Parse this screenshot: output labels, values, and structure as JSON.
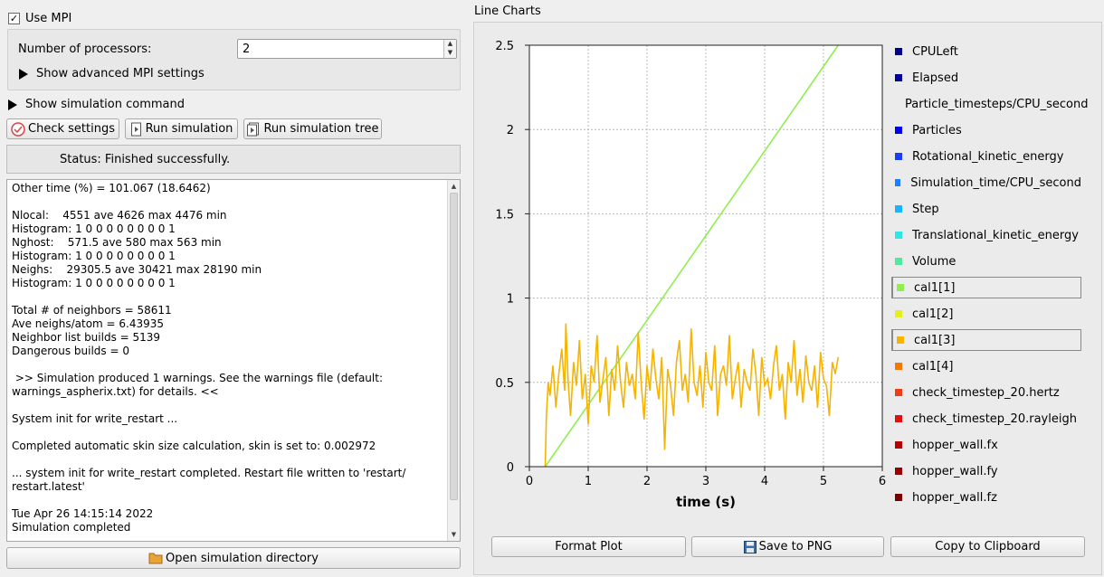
{
  "mpi": {
    "use_mpi_label": "Use MPI",
    "use_mpi_checked": true,
    "processors_label": "Number of processors:",
    "processors_value": "2",
    "advanced_label": "Show advanced MPI settings"
  },
  "sim_cmd_label": "Show simulation command",
  "toolbar": {
    "check_label": "Check settings",
    "run_label": "Run simulation",
    "run_tree_label": "Run simulation tree"
  },
  "status_text": "Status: Finished successfully.",
  "log_lines": [
    "Other time (%) = 101.067 (18.6462)",
    "",
    "Nlocal:    4551 ave 4626 max 4476 min",
    "Histogram: 1 0 0 0 0 0 0 0 0 1",
    "Nghost:    571.5 ave 580 max 563 min",
    "Histogram: 1 0 0 0 0 0 0 0 0 1",
    "Neighs:    29305.5 ave 30421 max 28190 min",
    "Histogram: 1 0 0 0 0 0 0 0 0 1",
    "",
    "Total # of neighbors = 58611",
    "Ave neighs/atom = 6.43935",
    "Neighbor list builds = 5139",
    "Dangerous builds = 0",
    "",
    " >> Simulation produced 1 warnings. See the warnings file (default:",
    "warnings_aspherix.txt) for details. <<",
    "",
    "System init for write_restart ...",
    "",
    "Completed automatic skin size calculation, skin is set to: 0.002972",
    "",
    "... system init for write_restart completed. Restart file written to 'restart/",
    "restart.latest'",
    "",
    "Tue Apr 26 14:15:14 2022",
    "Simulation completed"
  ],
  "open_dir_label": "Open simulation directory",
  "line_charts_title": "Line Charts",
  "bottom_buttons": {
    "format": "Format Plot",
    "save_png": "Save to PNG",
    "copy": "Copy to Clipboard"
  },
  "legend": [
    {
      "label": "CPULeft",
      "color": "#00008b",
      "selected": false
    },
    {
      "label": "Elapsed",
      "color": "#000099",
      "selected": false
    },
    {
      "label": "Particle_timesteps/CPU_second",
      "color": "#0000cc",
      "selected": false
    },
    {
      "label": "Particles",
      "color": "#0000ee",
      "selected": false
    },
    {
      "label": "Rotational_kinetic_energy",
      "color": "#1a3cff",
      "selected": false
    },
    {
      "label": "Simulation_time/CPU_second",
      "color": "#1e82ff",
      "selected": false
    },
    {
      "label": "Step",
      "color": "#19b4ff",
      "selected": false
    },
    {
      "label": "Translational_kinetic_energy",
      "color": "#2ee6e6",
      "selected": false
    },
    {
      "label": "Volume",
      "color": "#55e6a0",
      "selected": false
    },
    {
      "label": "cal1[1]",
      "color": "#90ee50",
      "selected": true
    },
    {
      "label": "cal1[2]",
      "color": "#e6ee1e",
      "selected": false
    },
    {
      "label": "cal1[3]",
      "color": "#f5b400",
      "selected": true
    },
    {
      "label": "cal1[4]",
      "color": "#f57800",
      "selected": false
    },
    {
      "label": "check_timestep_20.hertz",
      "color": "#f03c14",
      "selected": false
    },
    {
      "label": "check_timestep_20.rayleigh",
      "color": "#e01010",
      "selected": false
    },
    {
      "label": "hopper_wall.fx",
      "color": "#b40000",
      "selected": false
    },
    {
      "label": "hopper_wall.fy",
      "color": "#960000",
      "selected": false
    },
    {
      "label": "hopper_wall.fz",
      "color": "#780000",
      "selected": false
    }
  ],
  "chart_data": {
    "type": "line",
    "xlabel": "time (s)",
    "ylabel": "",
    "xlim": [
      0,
      6
    ],
    "ylim": [
      0,
      2.5
    ],
    "x_ticks": [
      "0",
      "1",
      "2",
      "3",
      "4",
      "5",
      "6"
    ],
    "y_ticks": [
      "0",
      "0.5",
      "1",
      "1.5",
      "2",
      "2.5"
    ],
    "grid": true,
    "series": [
      {
        "name": "cal1[1]",
        "color": "#90ee50",
        "x": [
          0.27,
          5.25
        ],
        "y": [
          0.0,
          2.5
        ]
      },
      {
        "name": "cal1[3]",
        "color": "#f5b400",
        "x": [
          0.27,
          0.29,
          0.32,
          0.35,
          0.4,
          0.45,
          0.5,
          0.55,
          0.6,
          0.62,
          0.66,
          0.7,
          0.75,
          0.8,
          0.85,
          0.9,
          0.95,
          1.0,
          1.05,
          1.1,
          1.15,
          1.2,
          1.25,
          1.3,
          1.35,
          1.4,
          1.45,
          1.5,
          1.55,
          1.6,
          1.65,
          1.7,
          1.75,
          1.8,
          1.85,
          1.9,
          1.95,
          2.0,
          2.05,
          2.1,
          2.15,
          2.2,
          2.25,
          2.3,
          2.35,
          2.4,
          2.45,
          2.5,
          2.55,
          2.6,
          2.65,
          2.7,
          2.75,
          2.8,
          2.85,
          2.9,
          2.95,
          3.0,
          3.05,
          3.1,
          3.15,
          3.2,
          3.25,
          3.3,
          3.35,
          3.4,
          3.45,
          3.5,
          3.55,
          3.6,
          3.65,
          3.7,
          3.75,
          3.8,
          3.85,
          3.9,
          3.95,
          4.0,
          4.05,
          4.1,
          4.15,
          4.2,
          4.25,
          4.3,
          4.35,
          4.4,
          4.45,
          4.5,
          4.55,
          4.6,
          4.65,
          4.7,
          4.75,
          4.8,
          4.85,
          4.9,
          4.95,
          5.0,
          5.05,
          5.1,
          5.15,
          5.2,
          5.25
        ],
        "y": [
          0.0,
          0.3,
          0.5,
          0.42,
          0.6,
          0.35,
          0.55,
          0.7,
          0.45,
          0.85,
          0.5,
          0.3,
          0.62,
          0.48,
          0.75,
          0.4,
          0.55,
          0.25,
          0.6,
          0.5,
          0.78,
          0.38,
          0.52,
          0.65,
          0.3,
          0.58,
          0.45,
          0.72,
          0.5,
          0.35,
          0.62,
          0.48,
          0.55,
          0.4,
          0.8,
          0.5,
          0.28,
          0.6,
          0.45,
          0.7,
          0.52,
          0.4,
          0.65,
          0.1,
          0.58,
          0.48,
          0.3,
          0.62,
          0.75,
          0.45,
          0.55,
          0.38,
          0.82,
          0.5,
          0.42,
          0.6,
          0.35,
          0.68,
          0.5,
          0.45,
          0.72,
          0.3,
          0.55,
          0.6,
          0.48,
          0.78,
          0.4,
          0.52,
          0.62,
          0.35,
          0.58,
          0.5,
          0.45,
          0.7,
          0.55,
          0.3,
          0.65,
          0.48,
          0.52,
          0.4,
          0.6,
          0.72,
          0.45,
          0.55,
          0.28,
          0.62,
          0.5,
          0.75,
          0.42,
          0.58,
          0.38,
          0.66,
          0.5,
          0.45,
          0.6,
          0.35,
          0.68,
          0.52,
          0.48,
          0.3,
          0.62,
          0.55,
          0.65
        ]
      }
    ]
  }
}
